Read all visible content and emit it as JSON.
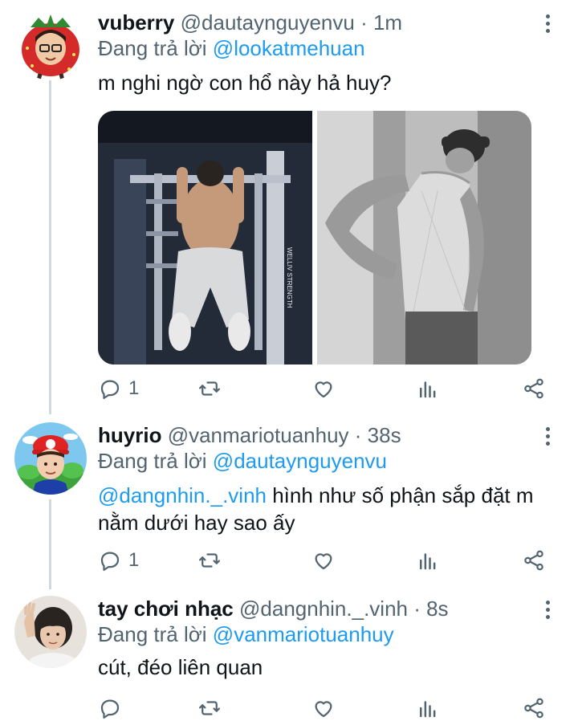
{
  "tweets": [
    {
      "display_name": "vuberry",
      "handle_time": "@dautaynguyenvu · 1m",
      "reply_prefix": "Đang trả lời",
      "reply_to": "@lookatmehuan",
      "text": "m nghi ngờ con hổ này hả huy?",
      "reply_count": "1",
      "photo_caption": "WELLIV STRENGTH"
    },
    {
      "display_name": "huyrio",
      "handle_time": "@vanmariotuanhuy · 38s",
      "reply_prefix": "Đang trả lời",
      "reply_to": "@dautaynguyenvu",
      "text_mention": "@dangnhin._.vinh",
      "text": " hình như số phận sắp đặt m nằm dưới hay sao ấy",
      "reply_count": "1"
    },
    {
      "display_name": "tay chơi nhạc",
      "handle_time": "@dangnhin._.vinh · 8s",
      "reply_prefix": "Đang trả lời",
      "reply_to": "@vanmariotuanhuy",
      "text": "cút, đéo liên quan",
      "reply_count": ""
    }
  ],
  "colors": {
    "link": "#1d9bf0",
    "secondary": "#536471",
    "thread_line": "#cfd9de"
  },
  "icons": [
    "reply-icon",
    "retweet-icon",
    "like-icon",
    "views-icon",
    "share-icon",
    "more-icon"
  ]
}
